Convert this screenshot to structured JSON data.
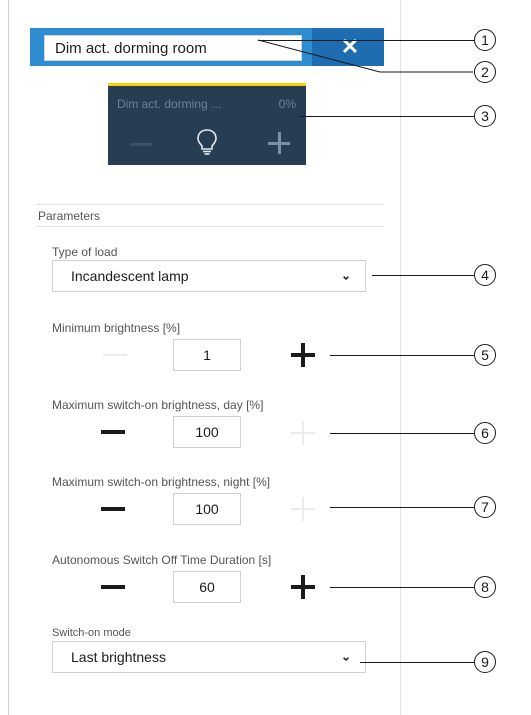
{
  "header": {
    "name_value": "Dim act. dorming room",
    "close_glyph": "✕",
    "accent": "#2e8dd1",
    "accent_dark": "#1e6db0"
  },
  "tile": {
    "name": "Dim act. dorming ...",
    "value": "0%",
    "background": "#273d52",
    "top_bar": "#f3d400",
    "icons": [
      "minus-icon",
      "lightbulb-icon",
      "plus-icon"
    ]
  },
  "parameters": {
    "title": "Parameters",
    "type_of_load": {
      "label": "Type of load",
      "value": "Incandescent lamp"
    },
    "min_brightness": {
      "label": "Minimum brightness [%]",
      "value": "1"
    },
    "max_day": {
      "label": "Maximum switch-on brightness, day [%]",
      "value": "100"
    },
    "max_night": {
      "label": "Maximum switch-on brightness, night [%]",
      "value": "100"
    },
    "switch_off": {
      "label": "Autonomous Switch Off Time Duration [s]",
      "value": "60"
    },
    "switch_on_mode": {
      "label": "Switch-on mode",
      "value": "Last brightness"
    },
    "chevron": "⌄"
  },
  "callouts": [
    "1",
    "2",
    "3",
    "4",
    "5",
    "6",
    "7",
    "8",
    "9"
  ]
}
